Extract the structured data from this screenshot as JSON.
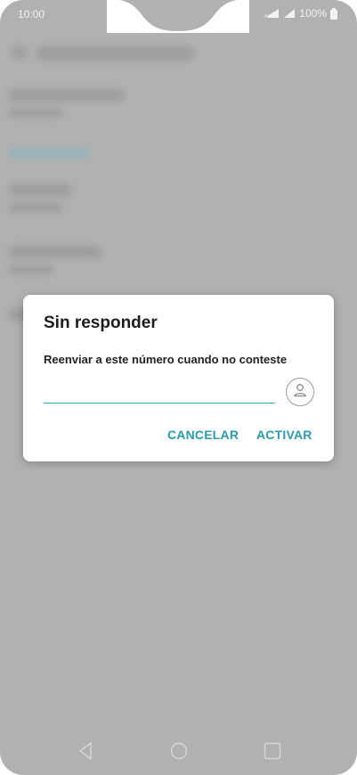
{
  "status_bar": {
    "time": "10:00",
    "battery": "100%"
  },
  "dialog": {
    "title": "Sin responder",
    "message": "Reenviar a este número cuando no conteste",
    "input_value": "",
    "cancel_label": "CANCELAR",
    "activate_label": "ACTIVAR"
  },
  "icons": {
    "contact": "contact-picker-icon",
    "back": "back-icon",
    "home": "home-icon",
    "recents": "recents-icon"
  },
  "colors": {
    "accent": "#2a9bb0",
    "scrim": "#b1b1b1",
    "dialog_bg": "#ffffff"
  }
}
